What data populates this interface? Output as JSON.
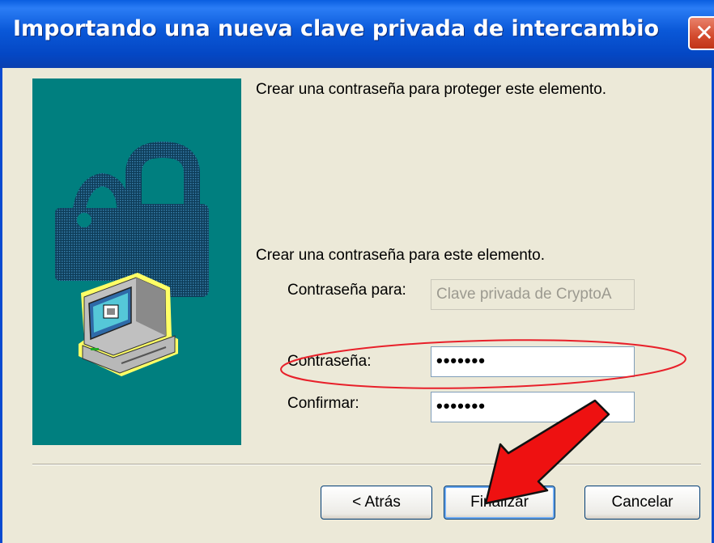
{
  "window": {
    "title": "Importando una nueva clave privada de intercambio",
    "close_symbol": "✕"
  },
  "content": {
    "intro": "Crear una contraseña para proteger este elemento.",
    "section_label": "Crear una contraseña para este elemento.",
    "password_for_label": "Contraseña para:",
    "password_for_value": "Clave privada de CryptoA",
    "password_label": "Contraseña:",
    "password_value": "•••••••",
    "confirm_label": "Confirmar:",
    "confirm_value": "•••••••"
  },
  "buttons": {
    "back": "< Atrás",
    "finish": "Finalizar",
    "cancel": "Cancelar"
  },
  "annotations": {
    "highlight_color": "#e8202a",
    "arrow_color": "#ee1111"
  },
  "icons": [
    "close-icon",
    "padlock-icon",
    "computer-icon",
    "red-arrow-annotation",
    "ellipse-annotation"
  ]
}
